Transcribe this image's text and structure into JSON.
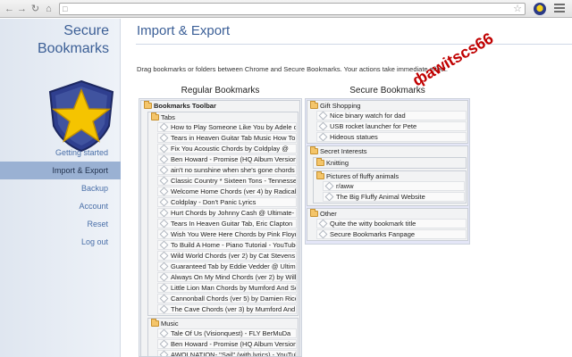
{
  "brand": {
    "line1": "Secure",
    "line2": "Bookmarks"
  },
  "nav": [
    {
      "label": "Getting started",
      "active": false
    },
    {
      "label": "Import & Export",
      "active": true
    },
    {
      "label": "Backup",
      "active": false
    },
    {
      "label": "Account",
      "active": false
    },
    {
      "label": "Reset",
      "active": false
    },
    {
      "label": "Log out",
      "active": false
    }
  ],
  "page": {
    "title": "Import & Export",
    "instructions": "Drag bookmarks or folders between Chrome and Secure Bookmarks. Your actions take immediate effect.",
    "watermark": "фаwitscs66"
  },
  "left": {
    "title": "Regular Bookmarks",
    "root": "Bookmarks Toolbar",
    "folders": [
      {
        "name": "Tabs",
        "items": [
          "How to Play Someone Like You by Adele on",
          "Tears in Heaven Guitar Tab Music How To",
          "Fix You Acoustic Chords by Coldplay @",
          "Ben Howard - Promise (HQ Album Version) -",
          "ain't no sunshine when she's gone chords -",
          "Classic Country * Sixteen Tons - Tennessee",
          "Welcome Home Chords (ver 4) by Radical",
          "Coldplay - Don't Panic Lyrics",
          "Hurt Chords by Johnny Cash @ Ultimate-",
          "Tears In Heaven Guitar Tab, Eric Clapton",
          "Wish You Were Here Chords by Pink Floyd @",
          "To Build A Home - Piano Tutorial - YouTube",
          "Wild World Chords (ver 2) by Cat Stevens @",
          "Guaranteed Tab by Eddie Vedder @ Ultimate-",
          "Always On My Mind Chords (ver 2) by Willie",
          "Little Lion Man Chords by Mumford And Sons",
          "Cannonball Chords (ver 5) by Damien Rice @",
          "The Cave Chords (ver 3) by Mumford And"
        ]
      },
      {
        "name": "Music",
        "items": [
          "Tale Of Us (Visionquest) - FLY BerMuDa",
          "Ben Howard - Promise (HQ Album Version) -",
          "AWOLNATION- \"Sail\" (with lyrics) - YouTube"
        ]
      }
    ]
  },
  "right": {
    "title": "Secure Bookmarks",
    "folders": [
      {
        "name": "Gift Shopping",
        "items": [
          "Nice binary watch for dad",
          "USB rocket launcher for Pete",
          "Hideous statues"
        ],
        "subfolders": []
      },
      {
        "name": "Secret Interests",
        "items": [],
        "subfolders": [
          {
            "name": "Knitting",
            "items": []
          },
          {
            "name": "Pictures of fluffy animals",
            "items": [
              "r/aww",
              "The Big Fluffy Animal Website"
            ]
          }
        ]
      },
      {
        "name": "Other",
        "items": [
          "Quite the witty bookmark title",
          "Secure Bookmarks Fanpage"
        ],
        "subfolders": []
      }
    ]
  },
  "colors": {
    "brand": "#3c5f96",
    "nav_active": "#9ab1d3",
    "folder": "#f4c56a",
    "star": "#f5c400"
  }
}
